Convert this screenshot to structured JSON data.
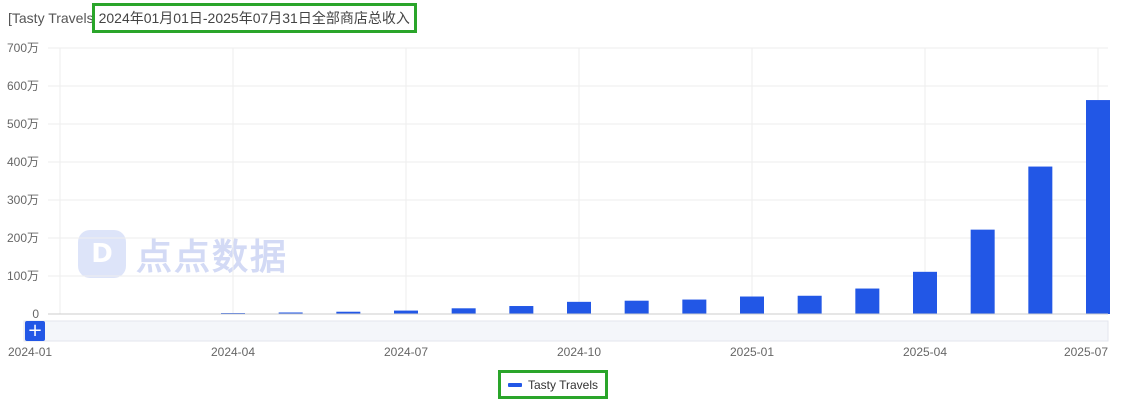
{
  "title": {
    "prefix": "[Tasty Travels",
    "highlight": "2024年01月01日-2025年07月31日全部商店总收入"
  },
  "watermark": {
    "logo": "D",
    "text": "点点数据"
  },
  "zoom": {
    "plus_label": "+"
  },
  "legend": {
    "label": "Tasty Travels"
  },
  "colors": {
    "bar": "#2257e6",
    "grid": "#eeeeee",
    "axis": "#cccccc",
    "highlight_border": "#2aa52a"
  },
  "chart_data": {
    "type": "bar",
    "x_tick_labels": [
      "2024-01",
      "2024-04",
      "2024-07",
      "2024-10",
      "2025-01",
      "2025-04",
      "2025-07"
    ],
    "y_tick_labels": [
      "0",
      "100万",
      "200万",
      "300万",
      "400万",
      "500万",
      "600万",
      "700万"
    ],
    "ylim": [
      0,
      7000000
    ],
    "series": [
      {
        "name": "Tasty Travels",
        "x": [
          "2024-01",
          "2024-02",
          "2024-03",
          "2024-04",
          "2024-05",
          "2024-06",
          "2024-07",
          "2024-08",
          "2024-09",
          "2024-10",
          "2024-11",
          "2024-12",
          "2025-01",
          "2025-02",
          "2025-03",
          "2025-04",
          "2025-05",
          "2025-06",
          "2025-07"
        ],
        "values": [
          0,
          0,
          0,
          20000,
          40000,
          60000,
          90000,
          150000,
          210000,
          320000,
          350000,
          380000,
          460000,
          480000,
          670000,
          1110000,
          2220000,
          3880000,
          5630000
        ]
      }
    ]
  }
}
